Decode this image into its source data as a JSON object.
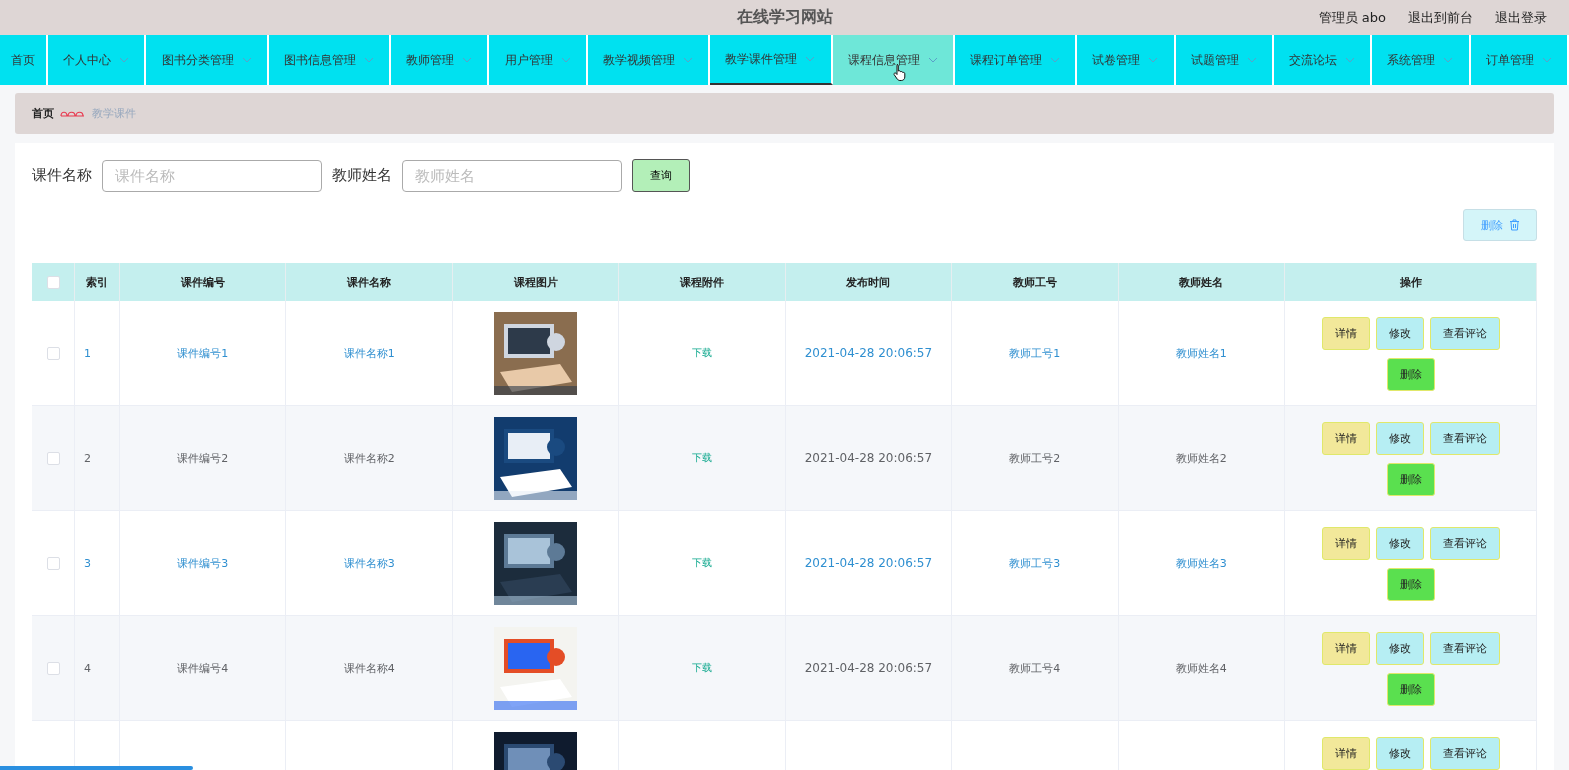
{
  "site_title": "在线学习网站",
  "user_links": [
    {
      "label": "管理员 abo"
    },
    {
      "label": "退出到前台"
    },
    {
      "label": "退出登录"
    }
  ],
  "nav": [
    {
      "label": "首页",
      "has_menu": false,
      "selected": false,
      "hovered": false
    },
    {
      "label": "个人中心",
      "has_menu": true,
      "selected": false,
      "hovered": false
    },
    {
      "label": "图书分类管理",
      "has_menu": true,
      "selected": false,
      "hovered": false
    },
    {
      "label": "图书信息管理",
      "has_menu": true,
      "selected": false,
      "hovered": false
    },
    {
      "label": "教师管理",
      "has_menu": true,
      "selected": false,
      "hovered": false
    },
    {
      "label": "用户管理",
      "has_menu": true,
      "selected": false,
      "hovered": false
    },
    {
      "label": "教学视频管理",
      "has_menu": true,
      "selected": false,
      "hovered": false
    },
    {
      "label": "教学课件管理",
      "has_menu": true,
      "selected": true,
      "hovered": false
    },
    {
      "label": "课程信息管理",
      "has_menu": true,
      "selected": false,
      "hovered": true
    },
    {
      "label": "课程订单管理",
      "has_menu": true,
      "selected": false,
      "hovered": false
    },
    {
      "label": "试卷管理",
      "has_menu": true,
      "selected": false,
      "hovered": false
    },
    {
      "label": "试题管理",
      "has_menu": true,
      "selected": false,
      "hovered": false
    },
    {
      "label": "交流论坛",
      "has_menu": true,
      "selected": false,
      "hovered": false
    },
    {
      "label": "系统管理",
      "has_menu": true,
      "selected": false,
      "hovered": false
    },
    {
      "label": "订单管理",
      "has_menu": true,
      "selected": false,
      "hovered": false
    }
  ],
  "breadcrumb": [
    {
      "label": "首页"
    },
    {
      "label": "教学课件"
    }
  ],
  "search": {
    "fields": [
      {
        "label": "课件名称",
        "placeholder": "课件名称"
      },
      {
        "label": "教师姓名",
        "placeholder": "教师姓名"
      }
    ],
    "button": "查询"
  },
  "bulk_delete": "删除",
  "table": {
    "columns": [
      "索引",
      "课件编号",
      "课件名称",
      "课程图片",
      "课程附件",
      "发布时间",
      "教师工号",
      "教师姓名",
      "操作"
    ],
    "header_checked": false,
    "rows": [
      {
        "checked": false,
        "highlighted": true,
        "index": "1",
        "code": "课件编号1",
        "name": "课件名称1",
        "image": {
          "kind": "picture"
        },
        "attachment": "下载",
        "time": "2021-04-28 20:06:57",
        "teacher_id": "教师工号1",
        "teacher_name": "教师姓名1",
        "actions": [
          "详情",
          "修改",
          "查看评论",
          "删除"
        ]
      },
      {
        "checked": false,
        "highlighted": false,
        "index": "2",
        "code": "课件编号2",
        "name": "课件名称2",
        "image": {
          "kind": "picture"
        },
        "attachment": "下载",
        "time": "2021-04-28 20:06:57",
        "teacher_id": "教师工号2",
        "teacher_name": "教师姓名2",
        "actions": [
          "详情",
          "修改",
          "查看评论",
          "删除"
        ]
      },
      {
        "checked": false,
        "highlighted": true,
        "index": "3",
        "code": "课件编号3",
        "name": "课件名称3",
        "image": {
          "kind": "picture"
        },
        "attachment": "下载",
        "time": "2021-04-28 20:06:57",
        "teacher_id": "教师工号3",
        "teacher_name": "教师姓名3",
        "actions": [
          "详情",
          "修改",
          "查看评论",
          "删除"
        ]
      },
      {
        "checked": false,
        "highlighted": false,
        "index": "4",
        "code": "课件编号4",
        "name": "课件名称4",
        "image": {
          "kind": "picture"
        },
        "attachment": "下载",
        "time": "2021-04-28 20:06:57",
        "teacher_id": "教师工号4",
        "teacher_name": "教师姓名4",
        "actions": [
          "详情",
          "修改",
          "查看评论",
          "删除"
        ]
      },
      {
        "image": {
          "kind": "picture"
        },
        "actions": [
          "详情",
          "修改",
          "查看评论"
        ]
      }
    ]
  },
  "loading_bar": {
    "level": 0.123
  }
}
